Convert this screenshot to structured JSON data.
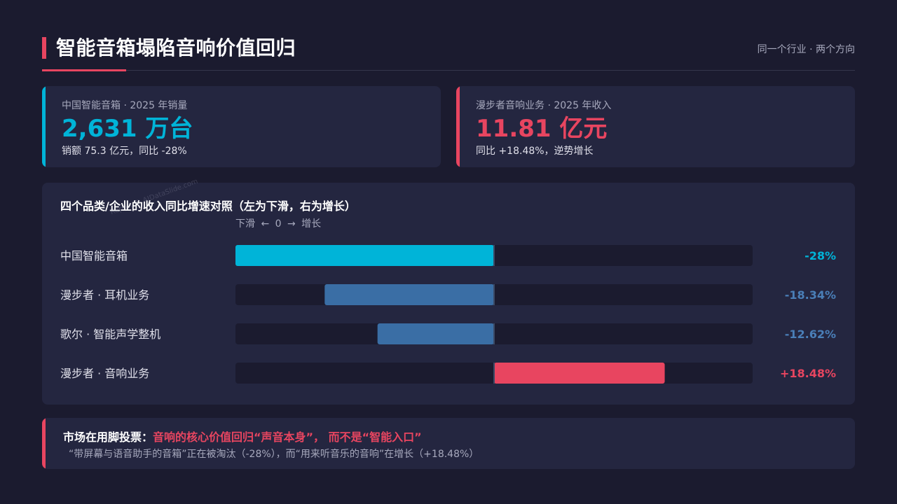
{
  "header": {
    "title": "智能音箱塌陷音响价值回归",
    "subtitle": "同一个行业 · 两个方向"
  },
  "cards": [
    {
      "label": "中国智能音箱 · 2025 年销量",
      "value": "2,631 万台",
      "desc": "销额 75.3 亿元，同比 -28%",
      "accent": "#00b4d8"
    },
    {
      "label": "漫步者音响业务 · 2025 年收入",
      "value": "11.81 亿元",
      "desc": "同比 +18.48%，逆势增长",
      "accent": "#e84560"
    }
  ],
  "watermark": "Report @ AIDataSlide.com",
  "chart_data": {
    "type": "bar",
    "orientation": "horizontal-diverging",
    "title": "四个品类/企业的收入同比增速对照（左为下滑，右为增长）",
    "axis_caption": "下滑 ← 0 → 增长",
    "unit": "%",
    "xlim": [
      -28,
      28
    ],
    "categories": [
      "中国智能音箱",
      "漫步者 · 耳机业务",
      "歌尔 · 智能声学整机",
      "漫步者 · 音响业务"
    ],
    "values": [
      -28,
      -18.34,
      -12.62,
      18.48
    ],
    "value_labels": [
      "-28%",
      "-18.34%",
      "-12.62%",
      "+18.48%"
    ],
    "colors": [
      "#00b4d8",
      "#3a6ea5",
      "#3a6ea5",
      "#e84560"
    ],
    "label_colors": [
      "#00b4d8",
      "#4a7fb8",
      "#4a7fb8",
      "#e84560"
    ],
    "track_color": "#1b1b2f",
    "zero_line_color": "#3b4a66"
  },
  "banner": {
    "lead": "市场在用脚投票：",
    "emphasis": "音响的核心价值回归“声音本身”， 而不是“智能入口”",
    "detail": "“带屏幕与语音助手的音箱”正在被淘汰（-28%），而“用来听音乐的音响”在增长（+18.48%）"
  }
}
